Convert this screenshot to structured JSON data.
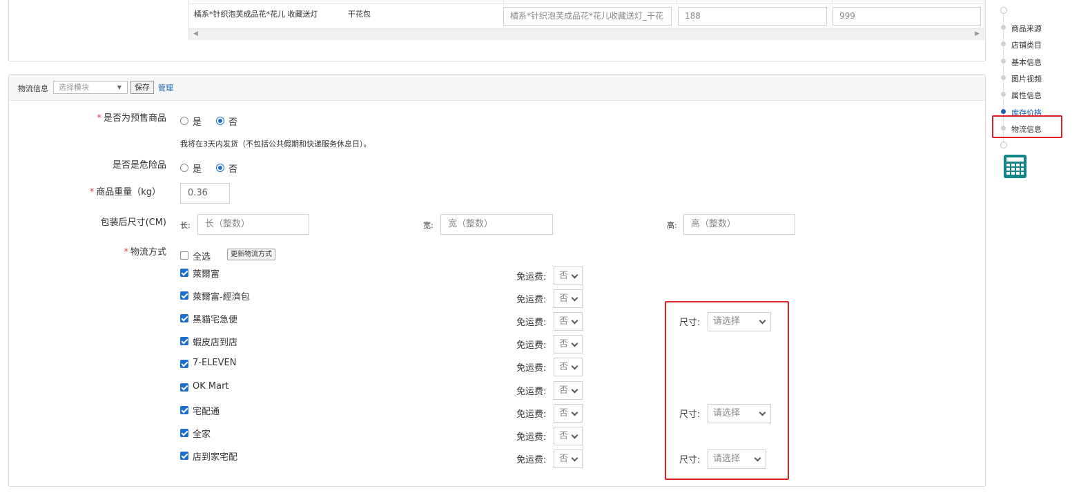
{
  "variant_table": {
    "row": {
      "name": "橘系*针织泡芙成品花*花儿 收藏送灯",
      "package": "干花包",
      "title_value": "橘系*针织泡芙成品花*花儿收藏送灯_干花",
      "price_value": "188",
      "stock_value": "999"
    }
  },
  "logistics": {
    "header": {
      "title": "物流信息",
      "template_placeholder": "选择模块",
      "save_label": "保存",
      "manage_label": "管理"
    },
    "presale": {
      "label": "是否为预售商品",
      "yes": "是",
      "no": "否",
      "selected": "否",
      "hint": "我将在3天内发货（不包括公共假期和快递服务休息日）。"
    },
    "dangerous": {
      "label": "是否是危险品",
      "yes": "是",
      "no": "否",
      "selected": "否"
    },
    "weight": {
      "label": "商品重量（kg）",
      "value": "0.36"
    },
    "dimensions": {
      "label": "包装后尺寸(CM)",
      "length_label": "长:",
      "length_placeholder": "长（整数）",
      "width_label": "宽:",
      "width_placeholder": "宽（整数）",
      "height_label": "高:",
      "height_placeholder": "高（整数）"
    },
    "methods": {
      "label": "物流方式",
      "select_all": "全选",
      "update_button": "更新物流方式",
      "free_ship_label": "免运费:",
      "size_label": "尺寸:",
      "size_placeholder": "请选择",
      "items": [
        {
          "name": "萊爾富",
          "checked": true,
          "free_shipping": "否",
          "has_size": false
        },
        {
          "name": "萊爾富-經濟包",
          "checked": true,
          "free_shipping": "否",
          "has_size": false
        },
        {
          "name": "黑貓宅急便",
          "checked": true,
          "free_shipping": "否",
          "has_size": true
        },
        {
          "name": "蝦皮店到店",
          "checked": true,
          "free_shipping": "否",
          "has_size": false
        },
        {
          "name": "7-ELEVEN",
          "checked": true,
          "free_shipping": "否",
          "has_size": false
        },
        {
          "name": "OK Mart",
          "checked": true,
          "free_shipping": "否",
          "has_size": false
        },
        {
          "name": "宅配通",
          "checked": true,
          "free_shipping": "否",
          "has_size": true
        },
        {
          "name": "全家",
          "checked": true,
          "free_shipping": "否",
          "has_size": false
        },
        {
          "name": "店到家宅配",
          "checked": true,
          "free_shipping": "否",
          "has_size": true
        }
      ]
    }
  },
  "side_nav": {
    "items": [
      {
        "label": "商品来源",
        "active": false
      },
      {
        "label": "店铺类目",
        "active": false
      },
      {
        "label": "基本信息",
        "active": false
      },
      {
        "label": "图片视频",
        "active": false
      },
      {
        "label": "属性信息",
        "active": false
      },
      {
        "label": "库存价格",
        "active": true
      },
      {
        "label": "物流信息",
        "active": false
      }
    ],
    "tool_icon": "calculator-icon"
  },
  "colors": {
    "primary": "#1c6fd0",
    "highlight_box": "#e02020",
    "link": "#1a66b8",
    "required": "#e4393c",
    "calculator": "#12858a"
  }
}
